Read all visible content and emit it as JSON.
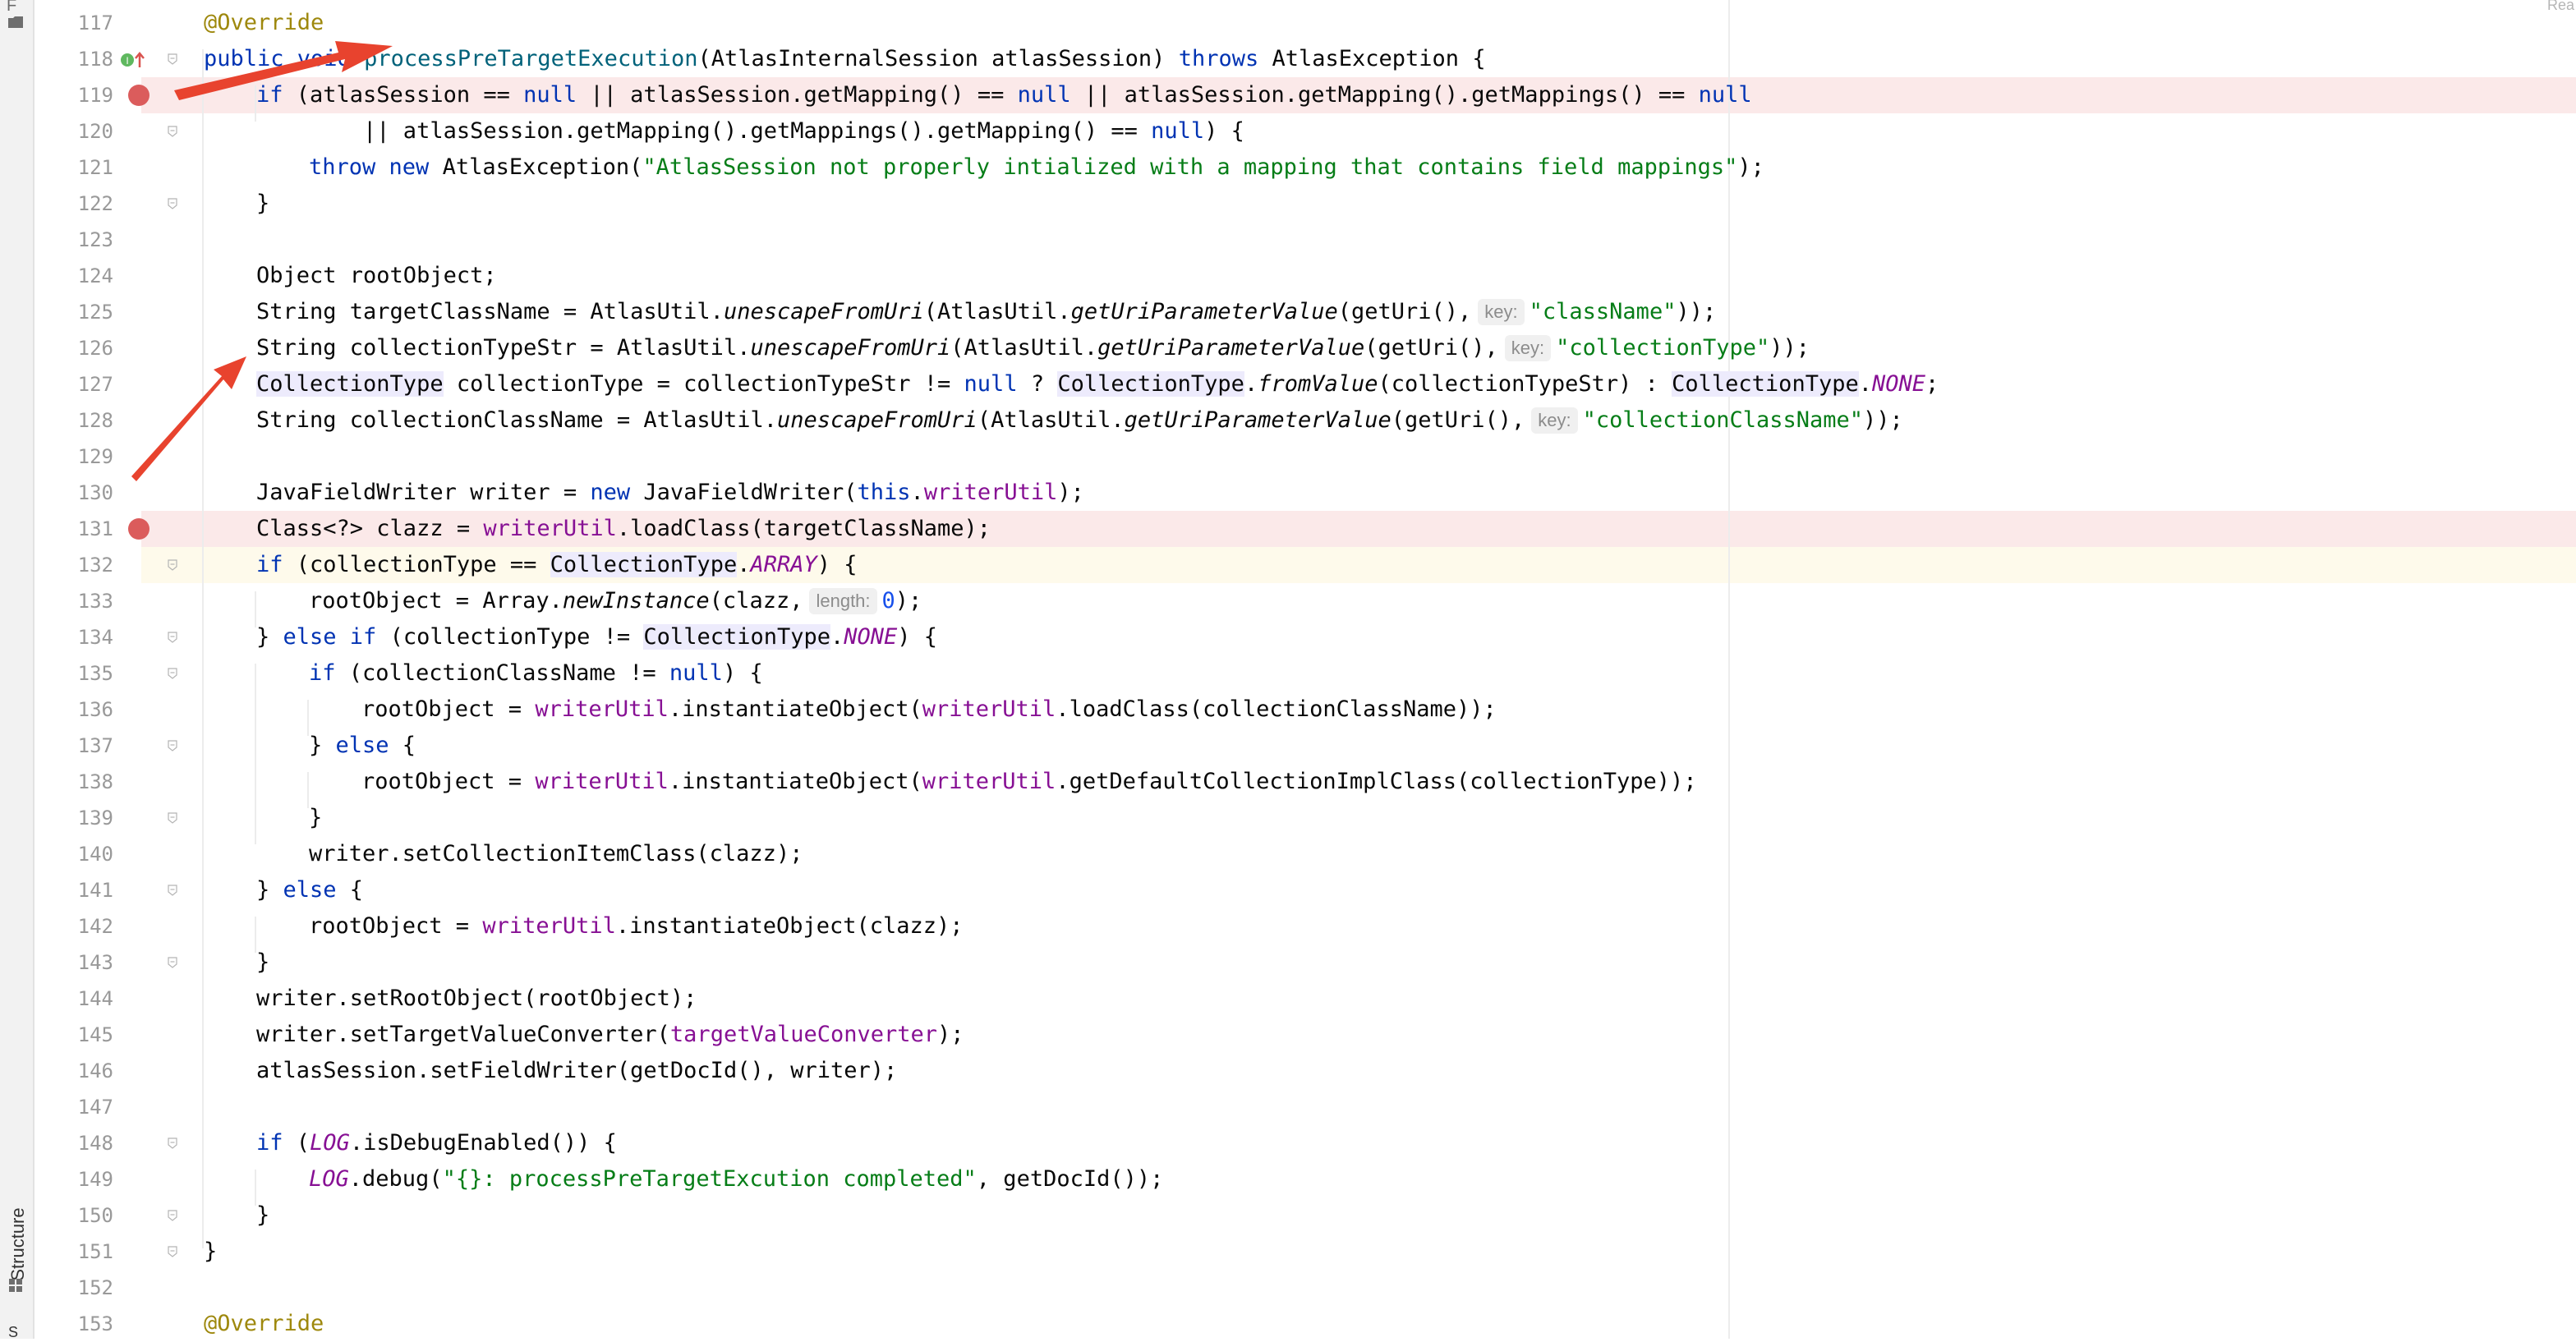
{
  "sidebar": {
    "top_label": "F",
    "structure_tab_label": "Structure",
    "bottom_label": "S"
  },
  "top_right_label": "Rea",
  "gutter": {
    "line_numbers": [
      "117",
      "118",
      "119",
      "120",
      "121",
      "122",
      "123",
      "124",
      "125",
      "126",
      "127",
      "128",
      "129",
      "130",
      "131",
      "132",
      "133",
      "134",
      "135",
      "136",
      "137",
      "138",
      "139",
      "140",
      "141",
      "142",
      "143",
      "144",
      "145",
      "146",
      "147",
      "148",
      "149",
      "150",
      "151",
      "152",
      "153"
    ],
    "breakpoint_lines": [
      "119",
      "131"
    ],
    "current_line": "132"
  },
  "code": {
    "l117": {
      "ann": "@Override"
    },
    "l118": {
      "a": "public ",
      "b": "void ",
      "c": "p",
      "d": "rocessPreTargetExecution",
      "e": "(AtlasInternalSession atlasSession) ",
      "f": "throws",
      "g": " AtlasException {"
    },
    "l119": {
      "a": "if",
      "b": " (atlasSession == ",
      "c": "null",
      "d": " || atlasSession.getMapping() == ",
      "e": "null",
      "f": " || atlasSession.getMapping().getMappings() == ",
      "g": "null"
    },
    "l120": {
      "a": "        || atlasSession.getMapping().getMappings().getMapping() == ",
      "b": "null",
      "c": ") {"
    },
    "l121": {
      "a": "throw ",
      "b": "new ",
      "c": "AtlasException(",
      "d": "\"AtlasSession not properly intialized with a mapping that contains field mappings\"",
      "e": ");"
    },
    "l122": {
      "a": "}"
    },
    "l124": {
      "a": "Object rootObject;"
    },
    "l125": {
      "a": "String targetClassName = AtlasUtil.",
      "b": "unescapeFromUri",
      "c": "(AtlasUtil.",
      "d": "getUriParameterValue",
      "e": "(getUri(),",
      "hint": "key:",
      "f": "\"className\"",
      "g": "));"
    },
    "l126": {
      "a": "String collectionTypeStr = AtlasUtil.",
      "b": "unescapeFromUri",
      "c": "(AtlasUtil.",
      "d": "getUriParameterValue",
      "e": "(getUri(),",
      "hint": "key:",
      "f": "\"collectionType\"",
      "g": "));"
    },
    "l127": {
      "t1": "CollectionType",
      "a": " collectionType = collectionTypeStr != ",
      "b": "null",
      "c": " ? ",
      "t2": "CollectionType",
      "d": ".",
      "e": "fromValue",
      "f": "(collectionTypeStr) : ",
      "t3": "CollectionType",
      "g": ".",
      "h": "NONE",
      "i": ";"
    },
    "l128": {
      "a": "String collectionClassName = AtlasUtil.",
      "b": "unescapeFromUri",
      "c": "(AtlasUtil.",
      "d": "getUriParameterValue",
      "e": "(getUri(),",
      "hint": "key:",
      "f": "\"collectionClassName\"",
      "g": "));"
    },
    "l130": {
      "a": "JavaFieldWriter writer = ",
      "b": "new ",
      "c": "JavaFieldWriter(",
      "d": "this",
      "e": ".",
      "f": "writerUtil",
      "g": ");"
    },
    "l131": {
      "a": "Class<?> clazz = ",
      "b": "writerUtil",
      "c": ".loadClass(targetClassName);"
    },
    "l132": {
      "a": "if",
      "b": " (collectionType == ",
      "t": "CollectionType",
      "c": ".",
      "d": "ARRAY",
      "e": ") {"
    },
    "l133": {
      "a": "rootObject = Array.",
      "b": "newInstance",
      "c": "(clazz,",
      "hint": "length:",
      "d": "0",
      "e": ");"
    },
    "l134": {
      "a": "} ",
      "b": "else if",
      "c": " (collectionType != ",
      "t": "CollectionType",
      "d": ".",
      "e": "NONE",
      "f": ") {"
    },
    "l135": {
      "a": "if",
      "b": " (collectionClassName != ",
      "c": "null",
      "d": ") {"
    },
    "l136": {
      "a": "rootObject = ",
      "b": "writerUtil",
      "c": ".instantiateObject(",
      "d": "writerUtil",
      "e": ".loadClass(collectionClassName));"
    },
    "l137": {
      "a": "} ",
      "b": "else",
      "c": " {"
    },
    "l138": {
      "a": "rootObject = ",
      "b": "writerUtil",
      "c": ".instantiateObject(",
      "d": "writerUtil",
      "e": ".getDefaultCollectionImplClass(collectionType));"
    },
    "l139": {
      "a": "}"
    },
    "l140": {
      "a": "writer.setCollectionItemClass(clazz);"
    },
    "l141": {
      "a": "} ",
      "b": "else",
      "c": " {"
    },
    "l142": {
      "a": "rootObject = ",
      "b": "writerUtil",
      "c": ".instantiateObject(clazz);"
    },
    "l143": {
      "a": "}"
    },
    "l144": {
      "a": "writer.setRootObject(rootObject);"
    },
    "l145": {
      "a": "writer.setTargetValueConverter(",
      "b": "targetValueConverter",
      "c": ");"
    },
    "l146": {
      "a": "atlasSession.setFieldWriter(getDocId(), writer);"
    },
    "l148": {
      "a": "if",
      "b": " (",
      "c": "LOG",
      "d": ".isDebugEnabled()) {"
    },
    "l149": {
      "a": "LOG",
      "b": ".debug(",
      "c": "\"{}: processPreTargetExcution completed\"",
      "d": ", getDocId());"
    },
    "l150": {
      "a": "}"
    },
    "l151": {
      "a": "}"
    },
    "l153": {
      "ann": "@Override"
    }
  },
  "colors": {
    "keyword": "#0033b3",
    "annotation": "#9e880d",
    "string": "#067d17",
    "field": "#871094",
    "breakpoint": "#db5c5c",
    "arrow": "#e8432e"
  }
}
